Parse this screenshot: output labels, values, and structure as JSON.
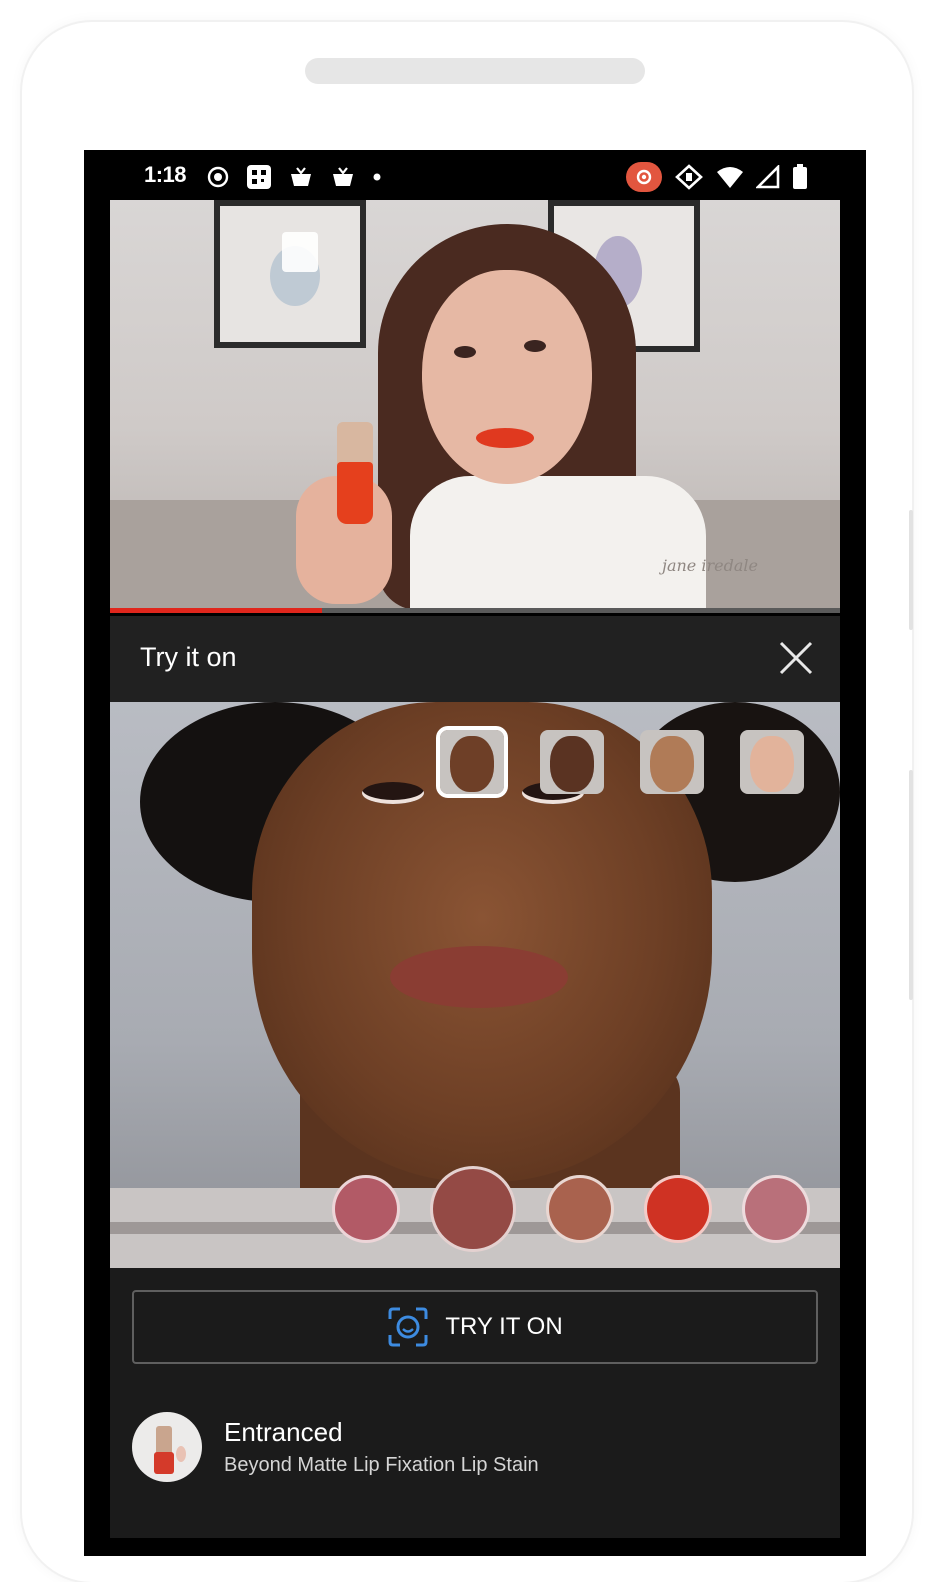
{
  "status_bar": {
    "time": "1:18"
  },
  "video": {
    "watermark": "jane iredale",
    "progress_fraction": 0.29
  },
  "panel": {
    "title": "Try it on"
  },
  "try_on_button": {
    "label": "TRY IT ON"
  },
  "product": {
    "name": "Entranced",
    "description": "Beyond Matte Lip Fixation Lip Stain"
  },
  "model_thumbnails": [
    {
      "id": "model-1",
      "selected": true,
      "skin": "#6e3f27"
    },
    {
      "id": "model-2",
      "selected": false,
      "skin": "#5a3322"
    },
    {
      "id": "model-3",
      "selected": false,
      "skin": "#b07b57"
    },
    {
      "id": "model-4",
      "selected": false,
      "skin": "#e2b39b"
    }
  ],
  "shades": [
    {
      "color": "#b25a66",
      "selected": false
    },
    {
      "color": "#944a45",
      "selected": true
    },
    {
      "color": "#a9624e",
      "selected": false
    },
    {
      "color": "#cf3223",
      "selected": false
    },
    {
      "color": "#b9707a",
      "selected": false
    }
  ],
  "colors": {
    "accent_red": "#e0261c",
    "icon_blue": "#3d8be0",
    "panel_bg": "#212121"
  }
}
